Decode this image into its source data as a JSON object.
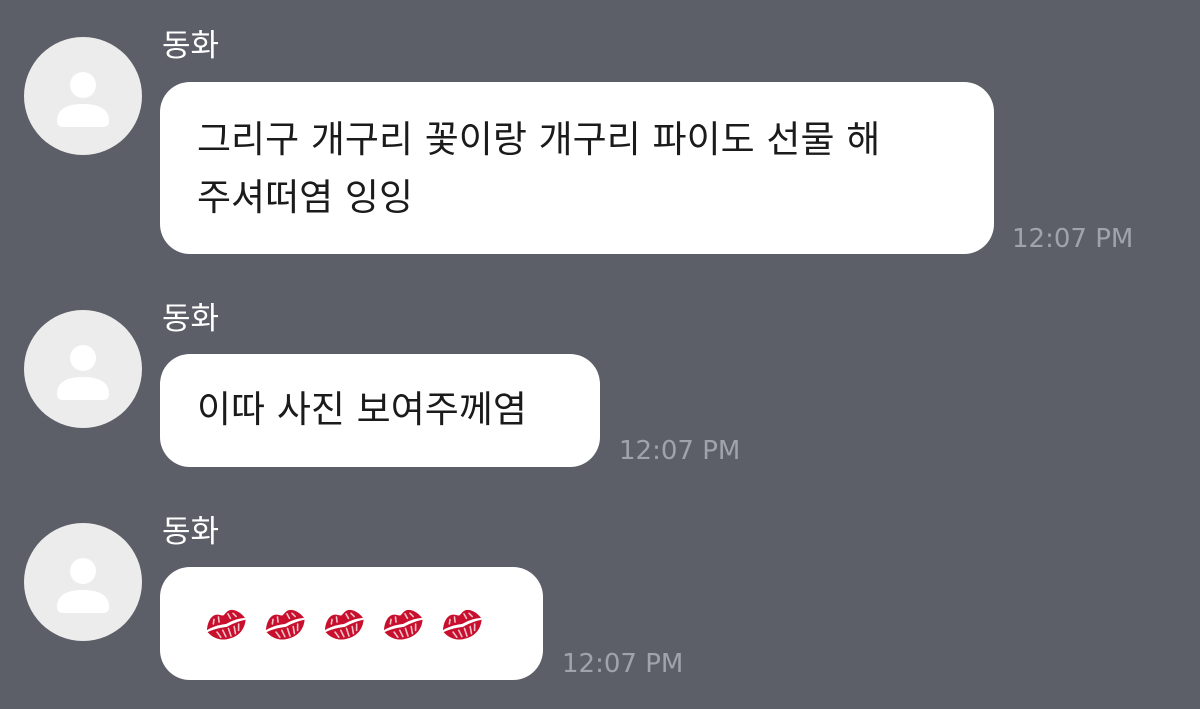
{
  "conversation": {
    "messages": [
      {
        "sender": "동화",
        "text": "그리구 개구리 꽃이랑 개구리 파이도 선물 해\n주셔떠염 잉잉",
        "time": "12:07 PM"
      },
      {
        "sender": "동화",
        "text": "이따 사진 보여주께염",
        "time": "12:07 PM"
      },
      {
        "sender": "동화",
        "emoji": [
          "kiss-mark",
          "kiss-mark",
          "kiss-mark",
          "kiss-mark",
          "kiss-mark"
        ],
        "time": "12:07 PM"
      }
    ]
  },
  "colors": {
    "background": "#5c5f68",
    "bubble": "#ffffff",
    "avatar": "#ececec",
    "avatar_figure": "#ffffff",
    "timestamp": "#a0a3aa",
    "kiss_mark": "#c8102e"
  }
}
